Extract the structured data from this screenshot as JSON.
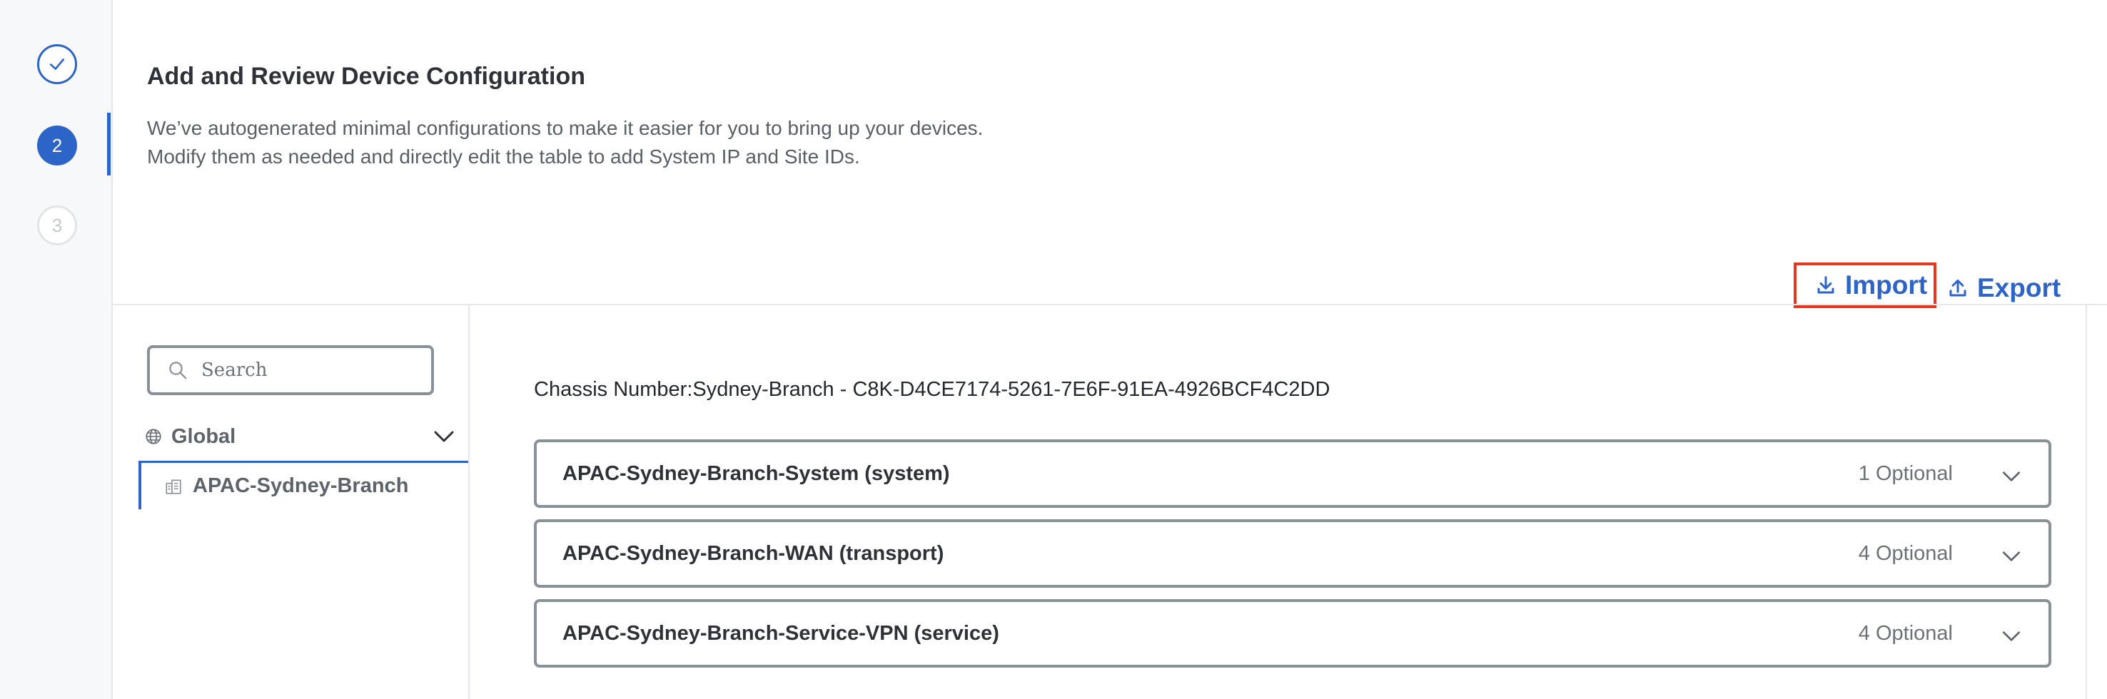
{
  "stepper": {
    "step1": {
      "state": "completed",
      "icon": "check-icon"
    },
    "step2": {
      "label": "2",
      "state": "active"
    },
    "step3": {
      "label": "3",
      "state": "upcoming"
    }
  },
  "header": {
    "title": "Add and Review Device Configuration",
    "desc_line1": "We’ve autogenerated minimal configurations to make it easier for you to bring up your devices.",
    "desc_line2": "Modify them as needed and directly edit the table to add System IP and Site IDs."
  },
  "actions": {
    "import_label": "Import",
    "import_icon": "download-icon",
    "export_label": "Export",
    "export_icon": "upload-icon"
  },
  "tree": {
    "search_placeholder": "Search",
    "search_value": "",
    "root": {
      "label": "Global",
      "icon": "globe-icon"
    },
    "items": [
      {
        "label": "APAC-Sydney-Branch",
        "icon": "building-icon",
        "selected": true
      }
    ]
  },
  "main": {
    "chassis": "Chassis Number:Sydney-Branch - C8K-D4CE7174-5261-7E6F-91EA-4926BCF4C2DD",
    "sections": [
      {
        "label": "APAC-Sydney-Branch-System (system)",
        "optional": "1 Optional"
      },
      {
        "label": "APAC-Sydney-Branch-WAN (transport)",
        "optional": "4 Optional"
      },
      {
        "label": "APAC-Sydney-Branch-Service-VPN (service)",
        "optional": "4 Optional"
      }
    ]
  },
  "colors": {
    "accent": "#2d64c8",
    "highlight": "#e5381f",
    "border": "#8a9099"
  }
}
